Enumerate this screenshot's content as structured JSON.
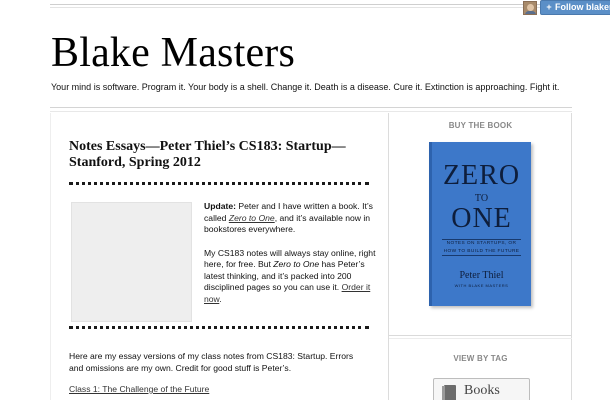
{
  "header": {
    "site_title": "Blake Masters",
    "tagline": "Your mind is software. Program it. Your body is a shell. Change it. Death is a disease. Cure it. Extinction is approaching. Fight it.",
    "follow_label": "Follow blakema",
    "follow_icon": "plus-icon"
  },
  "post": {
    "title": "Notes Essays—Peter Thiel’s CS183: Startup—Stanford, Spring 2012",
    "update_label": "Update:",
    "p1_a": " Peter and I have written a book. It’s called ",
    "p1_book": "Zero to One",
    "p1_b": ", and it’s available now in bookstores everywhere.",
    "p2_a": "My CS183 notes will always stay online, right here, for free. But ",
    "p2_book": "Zero to One",
    "p2_b": " has Peter’s latest thinking, and it’s packed into 200 disciplined pages so you can use it. ",
    "p2_link": "Order it now",
    "p2_end": ".",
    "intro": "Here are my essay versions of my class notes from CS183: Startup. Errors and omissions are my own. Credit for good stuff is Peter’s.",
    "class1_link": "Class 1: The Challenge of the Future"
  },
  "sidebar": {
    "buy_heading": "BUY THE BOOK",
    "book": {
      "title_top": "ZERO",
      "title_to": "TO",
      "title_bottom": "ONE",
      "subtitle_1": "NOTES ON STARTUPS, OR",
      "subtitle_2": "HOW TO BUILD THE FUTURE",
      "author": "Peter Thiel",
      "coauthor": "WITH BLAKE MASTERS",
      "cover_color": "#3d78c9"
    },
    "tag_heading": "VIEW BY TAG",
    "tag_button": {
      "label": "Books",
      "icon": "book-icon"
    }
  }
}
